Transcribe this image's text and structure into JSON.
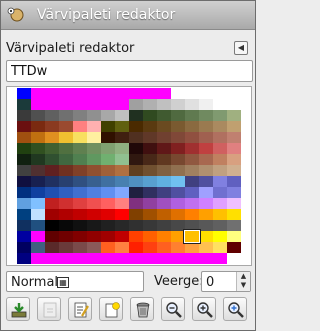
{
  "window": {
    "title": "Värvipaleti redaktor"
  },
  "dialog": {
    "title": "Värvipaleti redaktor"
  },
  "name_entry": {
    "value": "TTDw"
  },
  "palette": {
    "columns": 16,
    "selected_cell": "13-12",
    "rows": [
      [
        "#0000ff",
        "#ff00ff",
        "#ff00ff",
        "#ff00ff",
        "#ff00ff",
        "#ff00ff",
        "#ff00ff",
        "#ff00ff",
        "#ff00ff",
        "#ff00ff",
        "#ff00ff",
        "#ffffff",
        "#ffffff",
        "#ffffff",
        "#ffffff",
        "#ffffff"
      ],
      [
        "#1b3a3a",
        "#ff00ff",
        "#ff00ff",
        "#ff00ff",
        "#ff00ff",
        "#ff00ff",
        "#ff00ff",
        "#ff00ff",
        "#a0a0a0",
        "#b0b0b0",
        "#c0c0c0",
        "#d0d0d0",
        "#e0e0e0",
        "#f0f0f0",
        "#ffffff",
        "#ffffff"
      ],
      [
        "#3a3a3a",
        "#505050",
        "#606060",
        "#707070",
        "#808080",
        "#909090",
        "#a8a8a8",
        "#c0c0c0",
        "#203020",
        "#304a20",
        "#405a30",
        "#506a40",
        "#607a50",
        "#708a60",
        "#809a70",
        "#a0b080"
      ],
      [
        "#6a1010",
        "#7a2a10",
        "#8a3a20",
        "#9a4a30",
        "#ff8080",
        "#ffb0b0",
        "#404000",
        "#606010",
        "#4a2a00",
        "#5a3a10",
        "#6a4a20",
        "#7a5a30",
        "#8a6a40",
        "#9a7a50",
        "#aa8a60",
        "#c0a070"
      ],
      [
        "#a05010",
        "#c07010",
        "#e09020",
        "#f0c030",
        "#f8e060",
        "#fff0a0",
        "#301000",
        "#402010",
        "#503020",
        "#603828",
        "#704030",
        "#804838",
        "#905040",
        "#a06050",
        "#b07060",
        "#c08070"
      ],
      [
        "#204010",
        "#305020",
        "#406030",
        "#507040",
        "#608050",
        "#709060",
        "#80a070",
        "#90b080",
        "#200808",
        "#401010",
        "#601818",
        "#802020",
        "#a03030",
        "#c04040",
        "#d06060",
        "#e08080"
      ],
      [
        "#102010",
        "#203820",
        "#305030",
        "#406840",
        "#508050",
        "#609860",
        "#70b070",
        "#90c090",
        "#301810",
        "#482818",
        "#603820",
        "#784830",
        "#905840",
        "#a86850",
        "#c08060",
        "#d8a080"
      ],
      [
        "#404040",
        "#503030",
        "#602020",
        "#703020",
        "#804028",
        "#905030",
        "#a06038",
        "#b07040",
        "#604020",
        "#705030",
        "#806040",
        "#907050",
        "#a08060",
        "#b09070",
        "#c0a080",
        "#d0b090"
      ],
      [
        "#101040",
        "#182050",
        "#203060",
        "#284070",
        "#305080",
        "#386090",
        "#4070a0",
        "#4880b0",
        "#5090c0",
        "#58a0d0",
        "#60b0e0",
        "#70c0f0",
        "#404080",
        "#5050a0",
        "#8080e0",
        "#6060c0"
      ],
      [
        "#003080",
        "#1040a0",
        "#2050b0",
        "#3060c0",
        "#4070d0",
        "#5080e0",
        "#6090f0",
        "#80a8ff",
        "#202040",
        "#303060",
        "#404080",
        "#5050a0",
        "#6060c0",
        "#a0a0ff",
        "#7070d0",
        "#8080e0"
      ],
      [
        "#60a0e0",
        "#80c0ff",
        "#c02020",
        "#d03030",
        "#e04040",
        "#f05050",
        "#ff6060",
        "#ff8080",
        "#803080",
        "#9040a0",
        "#a050c0",
        "#b060e0",
        "#c070f0",
        "#d080ff",
        "#e0a0ff",
        "#f0c0ff"
      ],
      [
        "#004080",
        "#c0e0ff",
        "#a00000",
        "#b00000",
        "#c00000",
        "#d00000",
        "#e00000",
        "#ff0000",
        "#804000",
        "#a05000",
        "#c06000",
        "#e07000",
        "#ff8000",
        "#ffa000",
        "#ffc000",
        "#ffe000"
      ],
      [
        "#103060",
        "#205080",
        "#000000",
        "#080808",
        "#101010",
        "#181818",
        "#202020",
        "#282828",
        "#303030",
        "#383838",
        "#404040",
        "#484848",
        "#505050",
        "#585858",
        "#606060",
        "#707070"
      ],
      [
        "#0000a0",
        "#ff00ff",
        "#600000",
        "#700000",
        "#800000",
        "#900000",
        "#a00000",
        "#c00000",
        "#ff4000",
        "#ff6000",
        "#ff8000",
        "#ffa000",
        "#ffc000",
        "#ffe000",
        "#ffff00",
        "#ffff80"
      ],
      [
        "#000060",
        "#406080",
        "#5a2a2a",
        "#6a3a3a",
        "#7a4a4a",
        "#8a5a5a",
        "#ff6020",
        "#ff8040",
        "#ff2000",
        "#ff4010",
        "#ff6020",
        "#ff8030",
        "#ffa040",
        "#ffc050",
        "#ffe060",
        "#600000"
      ],
      [
        "#000080",
        "#ff00ff",
        "#ff00ff",
        "#ff00ff",
        "#ff00ff",
        "#ff00ff",
        "#ff00ff",
        "#ff00ff",
        "#ff00ff",
        "#ff00ff",
        "#ff00ff",
        "#ff00ff",
        "#ff00ff",
        "#ff00ff",
        "#ff00ff",
        "#ffffff"
      ]
    ]
  },
  "controls": {
    "mode_value": "Normal",
    "columns_label": "Veerge:",
    "columns_value": "0"
  },
  "toolbar": {
    "buttons": [
      {
        "name": "import-palette-button",
        "icon": "import-icon"
      },
      {
        "name": "export-palette-button",
        "icon": "export-icon"
      },
      {
        "name": "edit-color-button",
        "icon": "edit-icon"
      },
      {
        "name": "new-color-button",
        "icon": "new-color-icon"
      },
      {
        "name": "delete-color-button",
        "icon": "trash-icon"
      },
      {
        "name": "zoom-out-button",
        "icon": "zoom-out-icon"
      },
      {
        "name": "zoom-in-button",
        "icon": "zoom-in-icon"
      },
      {
        "name": "zoom-fit-button",
        "icon": "zoom-fit-icon"
      }
    ]
  }
}
